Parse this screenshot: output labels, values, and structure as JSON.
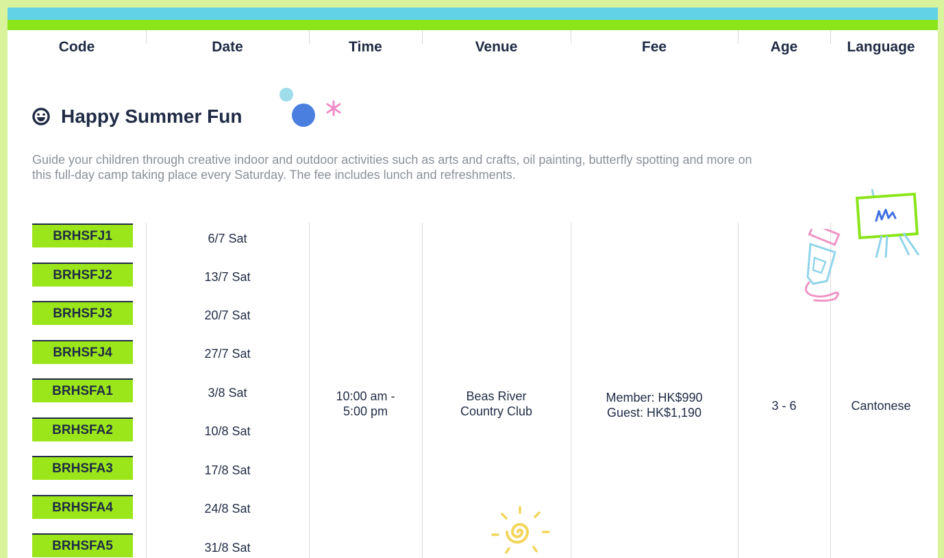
{
  "columns": [
    "Code",
    "Date",
    "Time",
    "Venue",
    "Fee",
    "Age",
    "Language"
  ],
  "section": {
    "title": "Happy Summer Fun",
    "description_line1": "Guide your children through creative indoor and outdoor activities such as arts and crafts, oil painting, butterfly spotting and more on",
    "description_line2": "this full-day camp taking place every Saturday. The fee includes lunch and refreshments."
  },
  "sessions": [
    {
      "code": "BRHSFJ1",
      "date": "6/7 Sat"
    },
    {
      "code": "BRHSFJ2",
      "date": "13/7 Sat"
    },
    {
      "code": "BRHSFJ3",
      "date": "20/7 Sat"
    },
    {
      "code": "BRHSFJ4",
      "date": "27/7 Sat"
    },
    {
      "code": "BRHSFA1",
      "date": "3/8 Sat"
    },
    {
      "code": "BRHSFA2",
      "date": "10/8 Sat"
    },
    {
      "code": "BRHSFA3",
      "date": "17/8 Sat"
    },
    {
      "code": "BRHSFA4",
      "date": "24/8 Sat"
    },
    {
      "code": "BRHSFA5",
      "date": "31/8 Sat"
    }
  ],
  "shared": {
    "time_line1": "10:00 am -",
    "time_line2": "5:00 pm",
    "venue_line1": "Beas River",
    "venue_line2": "Country Club",
    "fee_member": "Member: HK$990",
    "fee_guest": "Guest: HK$1,190",
    "age": "3 - 6",
    "language": "Cantonese"
  },
  "colors": {
    "frame": "#d8f39c",
    "band_blue": "#62d3e6",
    "band_green": "#8be51a",
    "badge": "#9be61a",
    "text_dark": "#1f2a44",
    "text_muted": "#8a9098"
  },
  "icons": [
    "smile-icon",
    "dots-decoration",
    "paint-tube-decoration",
    "easel-decoration",
    "sun-decoration"
  ]
}
